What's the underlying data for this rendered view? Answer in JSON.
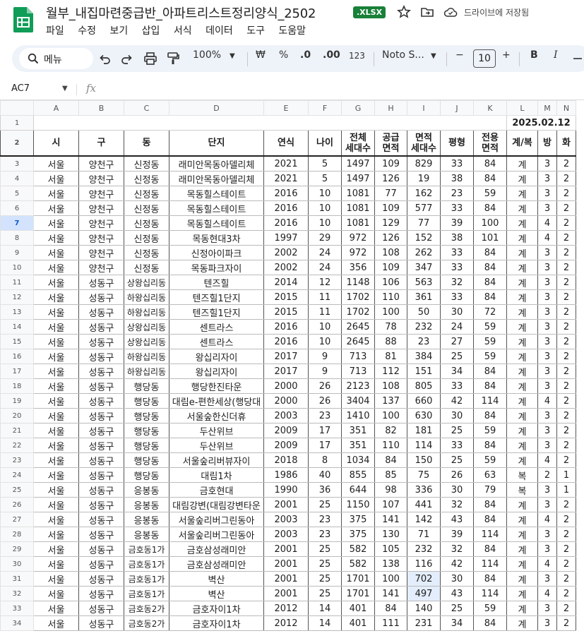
{
  "app": {
    "title": "월부_내집마련중급반_아파트리스트정리양식_2502",
    "format_badge": ".XLSX",
    "save_status": "드라이브에 저장됨",
    "accent": "#188038"
  },
  "menu": [
    "파일",
    "수정",
    "보기",
    "삽입",
    "서식",
    "데이터",
    "도구",
    "도움말"
  ],
  "toolbar": {
    "search_label": "메뉴",
    "zoom": "100%",
    "currency": "₩",
    "percent": "%",
    "dec_decrease": ".0",
    "dec_increase": ".00",
    "number_format": "123",
    "font": "Noto S...",
    "font_size": "10",
    "minus": "−",
    "plus": "+",
    "bold": "B",
    "italic": "I"
  },
  "formula_bar": {
    "cell_ref": "AC7",
    "fx": "fx",
    "value": ""
  },
  "sheet": {
    "columns": [
      "A",
      "B",
      "C",
      "D",
      "E",
      "F",
      "G",
      "H",
      "I",
      "J",
      "K",
      "L",
      "M",
      "N"
    ],
    "date": "2025.02.12",
    "headers": [
      "시",
      "구",
      "동",
      "단지",
      "연식",
      "나이",
      "전체\n세대수",
      "공급\n면적",
      "면적\n세대수",
      "평형",
      "전용\n면적",
      "계/복",
      "방",
      "화"
    ],
    "rows": [
      {
        "n": "3",
        "c": [
          "서울",
          "양천구",
          "신정동",
          "래미안목동아델리체",
          "2021",
          "5",
          "1497",
          "109",
          "829",
          "33",
          "84",
          "계",
          "3",
          "2"
        ]
      },
      {
        "n": "4",
        "c": [
          "서울",
          "양천구",
          "신정동",
          "래미안목동아델리체",
          "2021",
          "5",
          "1497",
          "126",
          "19",
          "38",
          "84",
          "계",
          "3",
          "2"
        ]
      },
      {
        "n": "5",
        "c": [
          "서울",
          "양천구",
          "신정동",
          "목동힐스테이트",
          "2016",
          "10",
          "1081",
          "77",
          "162",
          "23",
          "59",
          "계",
          "3",
          "2"
        ]
      },
      {
        "n": "6",
        "c": [
          "서울",
          "양천구",
          "신정동",
          "목동힐스테이트",
          "2016",
          "10",
          "1081",
          "109",
          "577",
          "33",
          "84",
          "계",
          "3",
          "2"
        ]
      },
      {
        "n": "7",
        "c": [
          "서울",
          "양천구",
          "신정동",
          "목동힐스테이트",
          "2016",
          "10",
          "1081",
          "129",
          "77",
          "39",
          "100",
          "계",
          "4",
          "2"
        ]
      },
      {
        "n": "8",
        "c": [
          "서울",
          "양천구",
          "신정동",
          "목동현대3차",
          "1997",
          "29",
          "972",
          "126",
          "152",
          "38",
          "101",
          "계",
          "4",
          "2"
        ]
      },
      {
        "n": "9",
        "c": [
          "서울",
          "양천구",
          "신정동",
          "신정아이파크",
          "2002",
          "24",
          "972",
          "108",
          "262",
          "33",
          "84",
          "계",
          "3",
          "2"
        ]
      },
      {
        "n": "10",
        "c": [
          "서울",
          "양천구",
          "신정동",
          "목동파크자이",
          "2002",
          "24",
          "356",
          "109",
          "347",
          "33",
          "84",
          "계",
          "3",
          "2"
        ]
      },
      {
        "n": "11",
        "c": [
          "서울",
          "성동구",
          "상왕십리동",
          "텐즈힐",
          "2014",
          "12",
          "1148",
          "106",
          "563",
          "32",
          "84",
          "계",
          "3",
          "2"
        ]
      },
      {
        "n": "12",
        "c": [
          "서울",
          "성동구",
          "하왕십리동",
          "텐즈힐1단지",
          "2015",
          "11",
          "1702",
          "110",
          "361",
          "33",
          "84",
          "계",
          "3",
          "2"
        ]
      },
      {
        "n": "13",
        "c": [
          "서울",
          "성동구",
          "하왕십리동",
          "텐즈힐1단지",
          "2015",
          "11",
          "1702",
          "100",
          "50",
          "30",
          "72",
          "계",
          "3",
          "2"
        ]
      },
      {
        "n": "14",
        "c": [
          "서울",
          "성동구",
          "상왕십리동",
          "센트라스",
          "2016",
          "10",
          "2645",
          "78",
          "232",
          "24",
          "59",
          "계",
          "3",
          "2"
        ]
      },
      {
        "n": "15",
        "c": [
          "서울",
          "성동구",
          "상왕십리동",
          "센트라스",
          "2016",
          "10",
          "2645",
          "88",
          "23",
          "27",
          "59",
          "계",
          "3",
          "2"
        ]
      },
      {
        "n": "16",
        "c": [
          "서울",
          "성동구",
          "하왕십리동",
          "왕십리자이",
          "2017",
          "9",
          "713",
          "81",
          "384",
          "25",
          "59",
          "계",
          "3",
          "2"
        ]
      },
      {
        "n": "17",
        "c": [
          "서울",
          "성동구",
          "하왕십리동",
          "왕십리자이",
          "2017",
          "9",
          "713",
          "112",
          "151",
          "34",
          "84",
          "계",
          "3",
          "2"
        ]
      },
      {
        "n": "18",
        "c": [
          "서울",
          "성동구",
          "행당동",
          "행당한진타운",
          "2000",
          "26",
          "2123",
          "108",
          "805",
          "33",
          "84",
          "계",
          "3",
          "2"
        ]
      },
      {
        "n": "19",
        "c": [
          "서울",
          "성동구",
          "행당동",
          "대림e-편한세상(행당대",
          "2000",
          "26",
          "3404",
          "137",
          "660",
          "42",
          "114",
          "계",
          "4",
          "2"
        ]
      },
      {
        "n": "20",
        "c": [
          "서울",
          "성동구",
          "행당동",
          "서울숲한신더휴",
          "2003",
          "23",
          "1410",
          "100",
          "630",
          "30",
          "84",
          "계",
          "3",
          "2"
        ]
      },
      {
        "n": "21",
        "c": [
          "서울",
          "성동구",
          "행당동",
          "두산위브",
          "2009",
          "17",
          "351",
          "82",
          "181",
          "25",
          "59",
          "계",
          "3",
          "2"
        ]
      },
      {
        "n": "22",
        "c": [
          "서울",
          "성동구",
          "행당동",
          "두산위브",
          "2009",
          "17",
          "351",
          "110",
          "114",
          "33",
          "84",
          "계",
          "3",
          "2"
        ]
      },
      {
        "n": "23",
        "c": [
          "서울",
          "성동구",
          "행당동",
          "서울숲리버뷰자이",
          "2018",
          "8",
          "1034",
          "84",
          "150",
          "25",
          "59",
          "계",
          "4",
          "2"
        ]
      },
      {
        "n": "24",
        "c": [
          "서울",
          "성동구",
          "행당동",
          "대림1차",
          "1986",
          "40",
          "855",
          "85",
          "75",
          "26",
          "63",
          "복",
          "2",
          "1"
        ]
      },
      {
        "n": "25",
        "c": [
          "서울",
          "성동구",
          "응봉동",
          "금호현대",
          "1990",
          "36",
          "644",
          "98",
          "336",
          "30",
          "79",
          "복",
          "3",
          "1"
        ]
      },
      {
        "n": "26",
        "c": [
          "서울",
          "성동구",
          "응봉동",
          "대림강변(대림강변타운",
          "2001",
          "25",
          "1150",
          "107",
          "441",
          "32",
          "84",
          "계",
          "3",
          "2"
        ]
      },
      {
        "n": "27",
        "c": [
          "서울",
          "성동구",
          "응봉동",
          "서울숲리버그린동아",
          "2003",
          "23",
          "375",
          "141",
          "142",
          "43",
          "84",
          "계",
          "4",
          "2"
        ]
      },
      {
        "n": "28",
        "c": [
          "서울",
          "성동구",
          "응봉동",
          "서울숲리버그린동아",
          "2003",
          "23",
          "375",
          "130",
          "71",
          "39",
          "114",
          "계",
          "3",
          "2"
        ]
      },
      {
        "n": "29",
        "c": [
          "서울",
          "성동구",
          "금호동1가",
          "금호삼성래미안",
          "2001",
          "25",
          "582",
          "105",
          "232",
          "32",
          "84",
          "계",
          "3",
          "2"
        ]
      },
      {
        "n": "30",
        "c": [
          "서울",
          "성동구",
          "금호동1가",
          "금호삼성래미안",
          "2001",
          "25",
          "582",
          "138",
          "116",
          "42",
          "114",
          "계",
          "4",
          "2"
        ]
      },
      {
        "n": "31",
        "c": [
          "서울",
          "성동구",
          "금호동1가",
          "벽산",
          "2001",
          "25",
          "1701",
          "100",
          "702",
          "30",
          "84",
          "계",
          "3",
          "2"
        ]
      },
      {
        "n": "32",
        "c": [
          "서울",
          "성동구",
          "금호동1가",
          "벽산",
          "2001",
          "25",
          "1701",
          "141",
          "497",
          "43",
          "114",
          "계",
          "4",
          "2"
        ]
      },
      {
        "n": "33",
        "c": [
          "서울",
          "성동구",
          "금호동2가",
          "금호자이1차",
          "2012",
          "14",
          "401",
          "84",
          "140",
          "25",
          "59",
          "계",
          "3",
          "2"
        ]
      },
      {
        "n": "34",
        "c": [
          "서울",
          "성동구",
          "금호동2가",
          "금호자이1차",
          "2012",
          "14",
          "401",
          "111",
          "231",
          "34",
          "84",
          "계",
          "3",
          "2"
        ]
      }
    ]
  }
}
